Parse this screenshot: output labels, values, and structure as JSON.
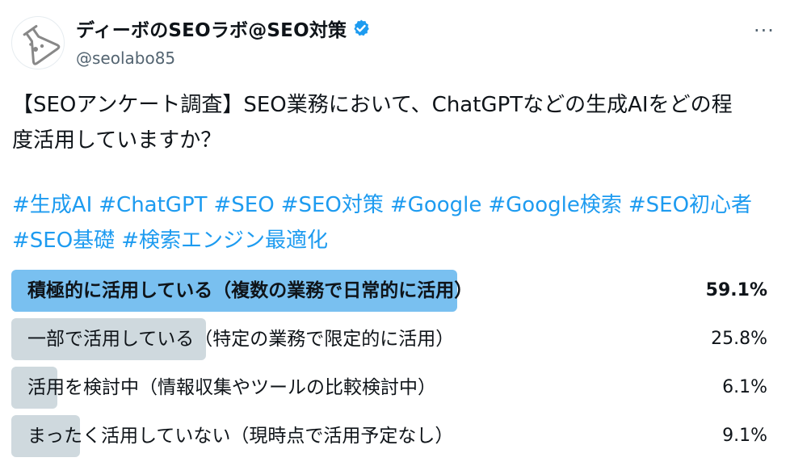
{
  "author": {
    "display_name": "ディーボのSEOラボ@SEO対策",
    "handle": "@seolabo85",
    "avatar_icon": "flask-icon",
    "verified_icon": "verified-badge-icon"
  },
  "more_button": "···",
  "tweet": {
    "text_lines": [
      "【SEOアンケート調査】SEO業務において、ChatGPTなどの生成AIをどの程",
      "度活用していますか？"
    ],
    "hashtags": [
      "#生成AI",
      "#ChatGPT",
      "#SEO",
      "#SEO対策",
      "#Google",
      "#Google検索",
      "#SEO初心者",
      "#SEO基礎",
      "#検索エンジン最適化"
    ]
  },
  "poll": {
    "options": [
      {
        "label": "積極的に活用している（複数の業務で日常的に活用）",
        "percent_text": "59.1%",
        "percent": 59.1,
        "winner": true
      },
      {
        "label": "一部で活用している（特定の業務で限定的に活用）",
        "percent_text": "25.8%",
        "percent": 25.8,
        "winner": false
      },
      {
        "label": "活用を検討中（情報収集やツールの比較検討中）",
        "percent_text": "6.1%",
        "percent": 6.1,
        "winner": false
      },
      {
        "label": "まったく活用していない（現時点で活用予定なし）",
        "percent_text": "9.1%",
        "percent": 9.1,
        "winner": false
      }
    ]
  },
  "colors": {
    "accent": "#1d9bf0",
    "winner_bar": "#79c0f0",
    "bar": "#cfd9de",
    "secondary_text": "#536471"
  }
}
